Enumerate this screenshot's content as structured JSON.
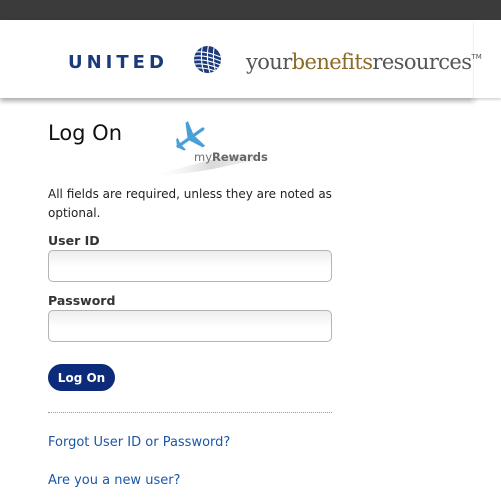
{
  "header": {
    "united_logo_text": "UNITED",
    "benefits_logo": {
      "part1": "your",
      "part2": "benefits",
      "part3": "resources",
      "trademark": "TM"
    }
  },
  "main": {
    "title": "Log On",
    "rewards_logo": {
      "prefix": "my",
      "suffix": "Rewards"
    },
    "instructions": "All fields are required, unless they are noted as optional.",
    "user_id": {
      "label": "User ID",
      "value": "",
      "placeholder": ""
    },
    "password": {
      "label": "Password",
      "value": "",
      "placeholder": ""
    },
    "logon_button": "Log On",
    "links": {
      "forgot": "Forgot User ID or Password?",
      "new_user": "Are you a new user?"
    }
  },
  "icons": {
    "globe": "united-globe-icon",
    "airplane": "airplane-icon"
  },
  "colors": {
    "top_strip": "#3b3b3b",
    "united_blue": "#1a3a7a",
    "benefits_gold": "#8c6a28",
    "button_bg": "#0c2b7a",
    "link": "#1c57a6",
    "airplane": "#4a9fd8"
  }
}
